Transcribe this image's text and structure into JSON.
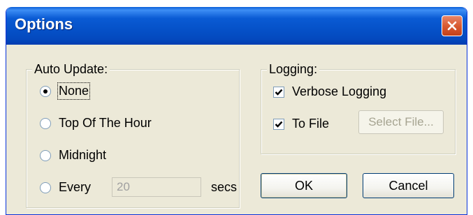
{
  "window": {
    "title": "Options"
  },
  "auto_update": {
    "legend": "Auto Update:",
    "options": [
      {
        "label": "None",
        "selected": true
      },
      {
        "label": "Top Of The Hour",
        "selected": false
      },
      {
        "label": "Midnight",
        "selected": false
      },
      {
        "label": "Every",
        "selected": false
      }
    ],
    "interval_value": "20",
    "interval_unit": "secs"
  },
  "logging": {
    "legend": "Logging:",
    "verbose_label": "Verbose Logging",
    "verbose_checked": true,
    "to_file_label": "To File",
    "to_file_checked": true,
    "select_file_label": "Select File..."
  },
  "buttons": {
    "ok_label": "OK",
    "cancel_label": "Cancel"
  },
  "colors": {
    "titlebar": "#0551c8",
    "close": "#d95b32",
    "face": "#ece9d8"
  }
}
